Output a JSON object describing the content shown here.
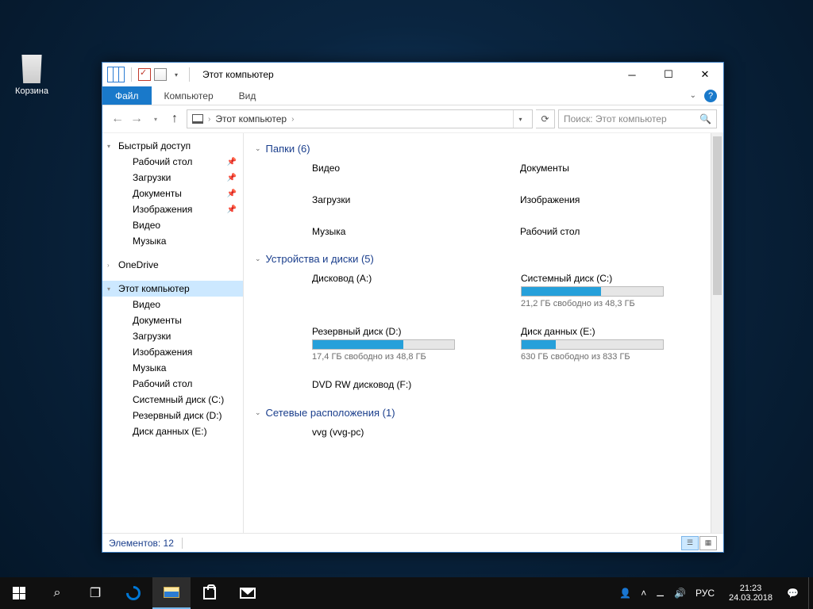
{
  "desktop": {
    "recycle_bin": "Корзина"
  },
  "window": {
    "title": "Этот компьютер",
    "tabs": {
      "file": "Файл",
      "computer": "Компьютер",
      "view": "Вид"
    },
    "address": {
      "crumb": "Этот компьютер"
    },
    "search": {
      "placeholder": "Поиск: Этот компьютер"
    }
  },
  "sidebar": {
    "quick_access": "Быстрый доступ",
    "quick_items": [
      {
        "label": "Рабочий стол",
        "pinned": true
      },
      {
        "label": "Загрузки",
        "pinned": true
      },
      {
        "label": "Документы",
        "pinned": true
      },
      {
        "label": "Изображения",
        "pinned": true
      },
      {
        "label": "Видео",
        "pinned": false
      },
      {
        "label": "Музыка",
        "pinned": false
      }
    ],
    "onedrive": "OneDrive",
    "this_pc": "Этот компьютер",
    "pc_items": [
      "Видео",
      "Документы",
      "Загрузки",
      "Изображения",
      "Музыка",
      "Рабочий стол",
      "Системный диск (C:)",
      "Резервный диск (D:)",
      "Диск данных (E:)"
    ]
  },
  "sections": {
    "folders": {
      "title": "Папки (6)",
      "items": [
        "Видео",
        "Документы",
        "Загрузки",
        "Изображения",
        "Музыка",
        "Рабочий стол"
      ]
    },
    "drives": {
      "title": "Устройства и диски (5)",
      "items": [
        {
          "name": "Дисковод (A:)",
          "bar": false
        },
        {
          "name": "Системный диск (C:)",
          "bar": true,
          "fill": 56,
          "sub": "21,2 ГБ свободно из 48,3 ГБ"
        },
        {
          "name": "Резервный диск (D:)",
          "bar": true,
          "fill": 64,
          "sub": "17,4 ГБ свободно из 48,8 ГБ"
        },
        {
          "name": "Диск данных (E:)",
          "bar": true,
          "fill": 24,
          "sub": "630 ГБ свободно из 833 ГБ"
        },
        {
          "name": "DVD RW дисковод (F:)",
          "bar": false
        }
      ]
    },
    "network": {
      "title": "Сетевые расположения (1)",
      "items": [
        "vvg (vvg-pc)"
      ]
    }
  },
  "statusbar": {
    "elements": "Элементов: 12"
  },
  "taskbar": {
    "lang": "РУС",
    "time": "21:23",
    "date": "24.03.2018"
  }
}
